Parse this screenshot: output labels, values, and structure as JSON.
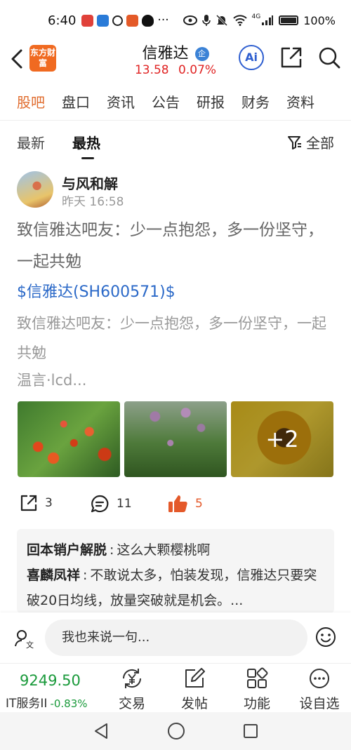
{
  "status_bar": {
    "time": "6:40",
    "more": "···",
    "network": "4G",
    "battery": "100%"
  },
  "header": {
    "logo_text": "东方财富",
    "stock_name": "信雅达",
    "badge": "企",
    "price": "13.58",
    "change_pct": "0.07%",
    "ai_label": "Ai"
  },
  "tabs": [
    "股吧",
    "盘口",
    "资讯",
    "公告",
    "研报",
    "财务",
    "资料"
  ],
  "subtabs": {
    "latest": "最新",
    "hot": "最热",
    "filter": "全部"
  },
  "post": {
    "author": "与风和解",
    "time": "昨天 16:58",
    "title": "致信雅达吧友：少一点抱怨，多一份坚守，一起共勉",
    "stock_link": "$信雅达(SH600571)$",
    "body": "致信雅达吧友：少一点抱怨，多一份坚守，一起共勉",
    "more": "温言·lcd...",
    "extra_images": "+2",
    "shares": "3",
    "comments": "11",
    "likes": "5"
  },
  "comments": [
    {
      "name": "回本销户解脱",
      "text": "这么大颗樱桃啊"
    },
    {
      "name": "喜麟凤祥",
      "text": "不敢说太多，怕装发现，信雅达只要突破20日均线，放量突破就是机会。..."
    }
  ],
  "input": {
    "placeholder": "我也来说一句..."
  },
  "bottom_bar": {
    "index_value": "9249.50",
    "index_name": "IT服务II",
    "index_change": "-0.83%",
    "nav": [
      "交易",
      "发帖",
      "功能",
      "设自选"
    ]
  },
  "colors": {
    "accent": "#e06b2c",
    "up": "#e02323",
    "down": "#1a9a3b",
    "link": "#2b69c8"
  }
}
